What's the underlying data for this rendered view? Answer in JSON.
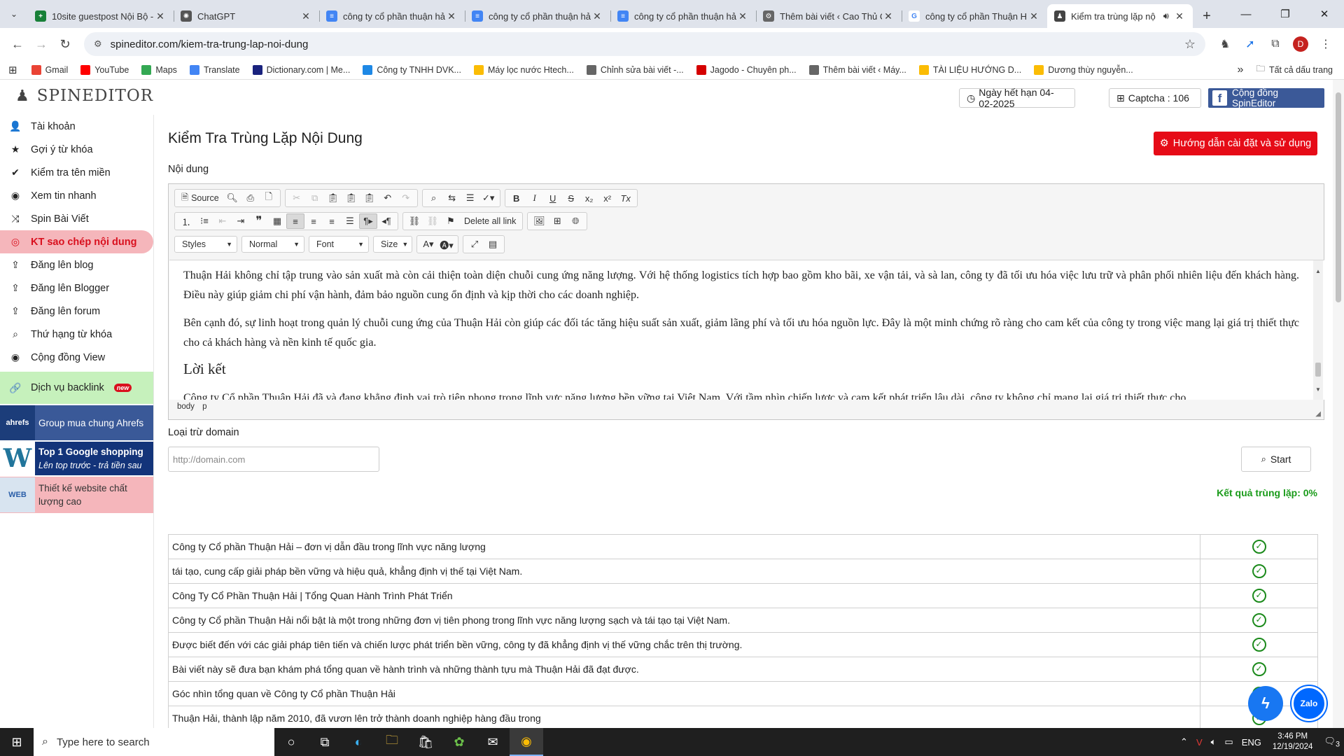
{
  "browser": {
    "tabs": [
      {
        "title": "10site guestpost Nội Bộ -",
        "icon_color": "#188038",
        "icon_label": "+"
      },
      {
        "title": "ChatGPT",
        "icon_color": "#555555",
        "icon_label": "✺"
      },
      {
        "title": "công ty cổ phần thuận hả",
        "icon_color": "#4285f4",
        "icon_label": "≡"
      },
      {
        "title": "công ty cổ phần thuận hả",
        "icon_color": "#4285f4",
        "icon_label": "≡"
      },
      {
        "title": "công ty cổ phần thuận hả",
        "icon_color": "#4285f4",
        "icon_label": "≡"
      },
      {
        "title": "Thêm bài viết ‹ Cao Thủ C",
        "icon_color": "#666666",
        "icon_label": "⚙"
      },
      {
        "title": "công ty cổ phần Thuận H",
        "icon_color": "#ffffff",
        "icon_label": "G"
      },
      {
        "title": "Kiểm tra trùng lặp nộ",
        "icon_color": "#444444",
        "icon_label": "♟",
        "active": true
      }
    ],
    "url": "spineditor.com/kiem-tra-trung-lap-noi-dung",
    "profile_initial": "D",
    "bookmarks": [
      {
        "label": "Gmail",
        "color": "#ea4335"
      },
      {
        "label": "YouTube",
        "color": "#ff0000"
      },
      {
        "label": "Maps",
        "color": "#34a853"
      },
      {
        "label": "Translate",
        "color": "#4285f4"
      },
      {
        "label": "Dictionary.com | Me...",
        "color": "#1a237e"
      },
      {
        "label": "Công ty TNHH DVK...",
        "color": "#1e88e5"
      },
      {
        "label": "Máy lọc nước Htech...",
        "color": "#fbbc04"
      },
      {
        "label": "Chỉnh sửa bài viết -...",
        "color": "#666666"
      },
      {
        "label": "Jagodo - Chuyên ph...",
        "color": "#d50000"
      },
      {
        "label": "Thêm bài viết ‹ Máy...",
        "color": "#666666"
      },
      {
        "label": "TÀI LIỆU HƯỚNG D...",
        "color": "#fbbc04"
      },
      {
        "label": "Dương thùy nguyễn...",
        "color": "#fbbc04"
      }
    ],
    "more_bookmarks": "»",
    "all_bookmarks": "Tất cả dấu trang"
  },
  "header": {
    "logo": "SPINEDITOR",
    "expiry": "Ngày hết hạn 04-02-2025",
    "captcha": "Captcha : 106",
    "community": "Cộng đồng SpinEditor"
  },
  "sidebar": {
    "items": [
      {
        "label": "Tài khoản",
        "icon": "user-icon",
        "glyph": "👤"
      },
      {
        "label": "Gợi ý từ khóa",
        "icon": "star-icon",
        "glyph": "★"
      },
      {
        "label": "Kiểm tra tên miền",
        "icon": "check-icon",
        "glyph": "✔"
      },
      {
        "label": "Xem tin nhanh",
        "icon": "eye-icon",
        "glyph": "◉"
      },
      {
        "label": "Spin Bài Viết",
        "icon": "shuffle-icon",
        "glyph": "⤨"
      },
      {
        "label": "KT sao chép nội dung",
        "icon": "target-icon",
        "glyph": "◎",
        "active": true
      },
      {
        "label": "Đăng lên blog",
        "icon": "upload-icon",
        "glyph": "⇪"
      },
      {
        "label": "Đăng lên Blogger",
        "icon": "upload-icon",
        "glyph": "⇪"
      },
      {
        "label": "Đăng lên forum",
        "icon": "upload-icon",
        "glyph": "⇪"
      },
      {
        "label": "Thứ hạng từ khóa",
        "icon": "search-icon",
        "glyph": "⌕"
      },
      {
        "label": "Cộng đồng View",
        "icon": "eye-icon",
        "glyph": "◉"
      }
    ],
    "backlink": "Dịch vụ backlink",
    "new_badge": "new",
    "promo_ahrefs": "Group mua chung Ahrefs",
    "promo_ahrefs_logo": "ahrefs",
    "promo_google_title": "Top 1 Google shopping",
    "promo_google_sub": "Lên top trước - trả tiền sau",
    "promo_google_logo": "W",
    "promo_web": "Thiết kế website chất lượng cao",
    "promo_web_logo": "WEB"
  },
  "main": {
    "title": "Kiểm Tra Trùng Lặp Nội Dung",
    "guide_button": "Hướng dẫn cài đặt và sử dụng",
    "content_label": "Nội dung",
    "toolbar": {
      "source": "Source",
      "delete_all_link": "Delete all link",
      "styles": "Styles",
      "format": "Normal",
      "font": "Font",
      "size": "Size"
    },
    "editor_paragraphs": [
      "Thuận Hải không chỉ tập trung vào sản xuất mà còn cải thiện toàn diện chuỗi cung ứng năng lượng. Với hệ thống logistics tích hợp bao gồm kho bãi, xe vận tải, và sà lan, công ty đã tối ưu hóa việc lưu trữ và phân phối nhiên liệu đến khách hàng. Điều này giúp giảm chi phí vận hành, đảm bảo nguồn cung ổn định và kịp thời cho các doanh nghiệp.",
      "Bên cạnh đó, sự linh hoạt trong quản lý chuỗi cung ứng của Thuận Hải còn giúp các đối tác tăng hiệu suất sản xuất, giảm lãng phí và tối ưu hóa nguồn lực. Đây là một minh chứng rõ ràng cho cam kết của công ty trong việc mang lại giá trị thiết thực cho cả khách hàng và nền kinh tế quốc gia."
    ],
    "editor_heading": "Lời kết",
    "editor_last": "Công ty Cổ phần Thuận Hải đã và đang khẳng định vai trò tiên phong trong lĩnh vực năng lượng bền vững tại Việt Nam. Với tầm nhìn chiến lược và cam kết phát triển lâu dài, công ty không chỉ mang lại giá trị thiết thực cho",
    "editor_path": [
      "body",
      "p"
    ],
    "exclude_label": "Loại trừ domain",
    "domain_placeholder": "http://domain.com",
    "start_button": "Start",
    "result": "Kết quả trùng lặp: 0%",
    "rows": [
      "Công ty Cổ phần Thuận Hải – đơn vị dẫn đầu trong lĩnh vực năng lượng",
      "tái tạo, cung cấp giải pháp bền vững và hiệu quả, khẳng định vị thế tại Việt Nam.",
      "Công Ty Cổ Phần Thuận Hải | Tổng Quan Hành Trình Phát Triển",
      "Công ty Cổ phần Thuận Hải nổi bật là một trong những đơn vị tiên phong trong lĩnh vực năng lượng sạch và tái tạo tại Việt Nam.",
      "Được biết đến với các giải pháp tiên tiến và chiến lược phát triển bền vững, công ty đã khẳng định vị thế vững chắc trên thị trường.",
      "Bài viết này sẽ đưa bạn khám phá tổng quan về hành trình và những thành tựu mà Thuận Hải đã đạt được.",
      "Góc nhìn tổng quan về Công ty Cổ phần Thuận Hải",
      "Thuận Hải, thành lập năm 2010, đã vươn lên trở thành doanh nghiệp hàng đầu trong"
    ]
  },
  "taskbar": {
    "search_placeholder": "Type here to search",
    "lang": "ENG",
    "time": "3:46 PM",
    "date": "12/19/2024",
    "notif_count": "3"
  }
}
